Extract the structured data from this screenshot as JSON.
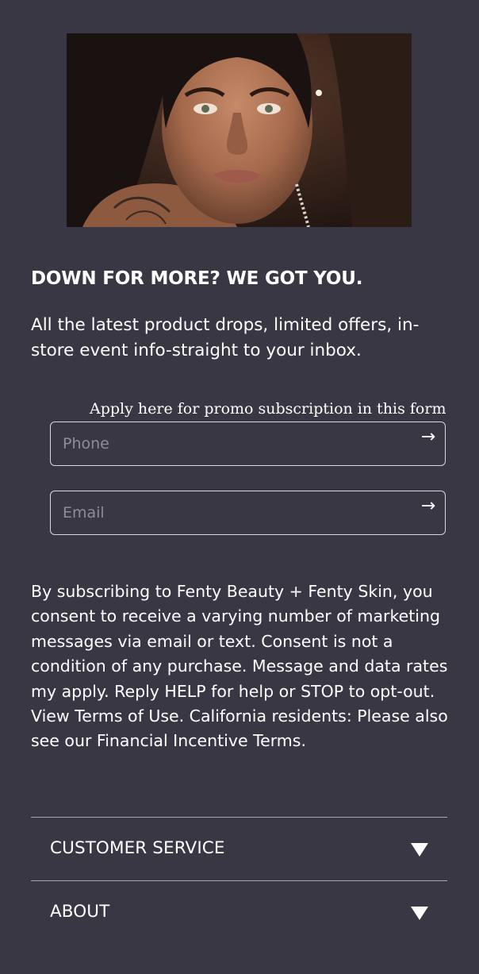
{
  "newsletter": {
    "hero_alt": "Portrait of a woman",
    "heading": "DOWN FOR MORE? WE GOT YOU.",
    "subtext": "All the latest product drops, limited offers, in-store event info-straight to your inbox.",
    "form_label": "Apply here for promo subscription in this form",
    "phone": {
      "placeholder": "Phone",
      "value": "",
      "submit_icon": "→"
    },
    "email": {
      "placeholder": "Email",
      "value": "",
      "submit_icon": "→"
    },
    "legal": "By subscribing to Fenty Beauty + Fenty Skin, you consent to receive a varying number of marketing messages via email or text. Consent is not a condition of any purchase. Message and data rates my apply. Reply HELP for help or STOP to opt-out. View Terms of Use. California residents: Please also see our Financial Incentive Terms."
  },
  "footer_nav": {
    "items": [
      {
        "label": "CUSTOMER SERVICE",
        "icon": "caret-down-icon"
      },
      {
        "label": "ABOUT",
        "icon": "caret-down-icon"
      }
    ]
  },
  "colors": {
    "background": "#3a3745",
    "text": "#ffffff",
    "placeholder": "#8f8c99",
    "border": "#d8d6de",
    "divider": "#a8a5b0"
  }
}
